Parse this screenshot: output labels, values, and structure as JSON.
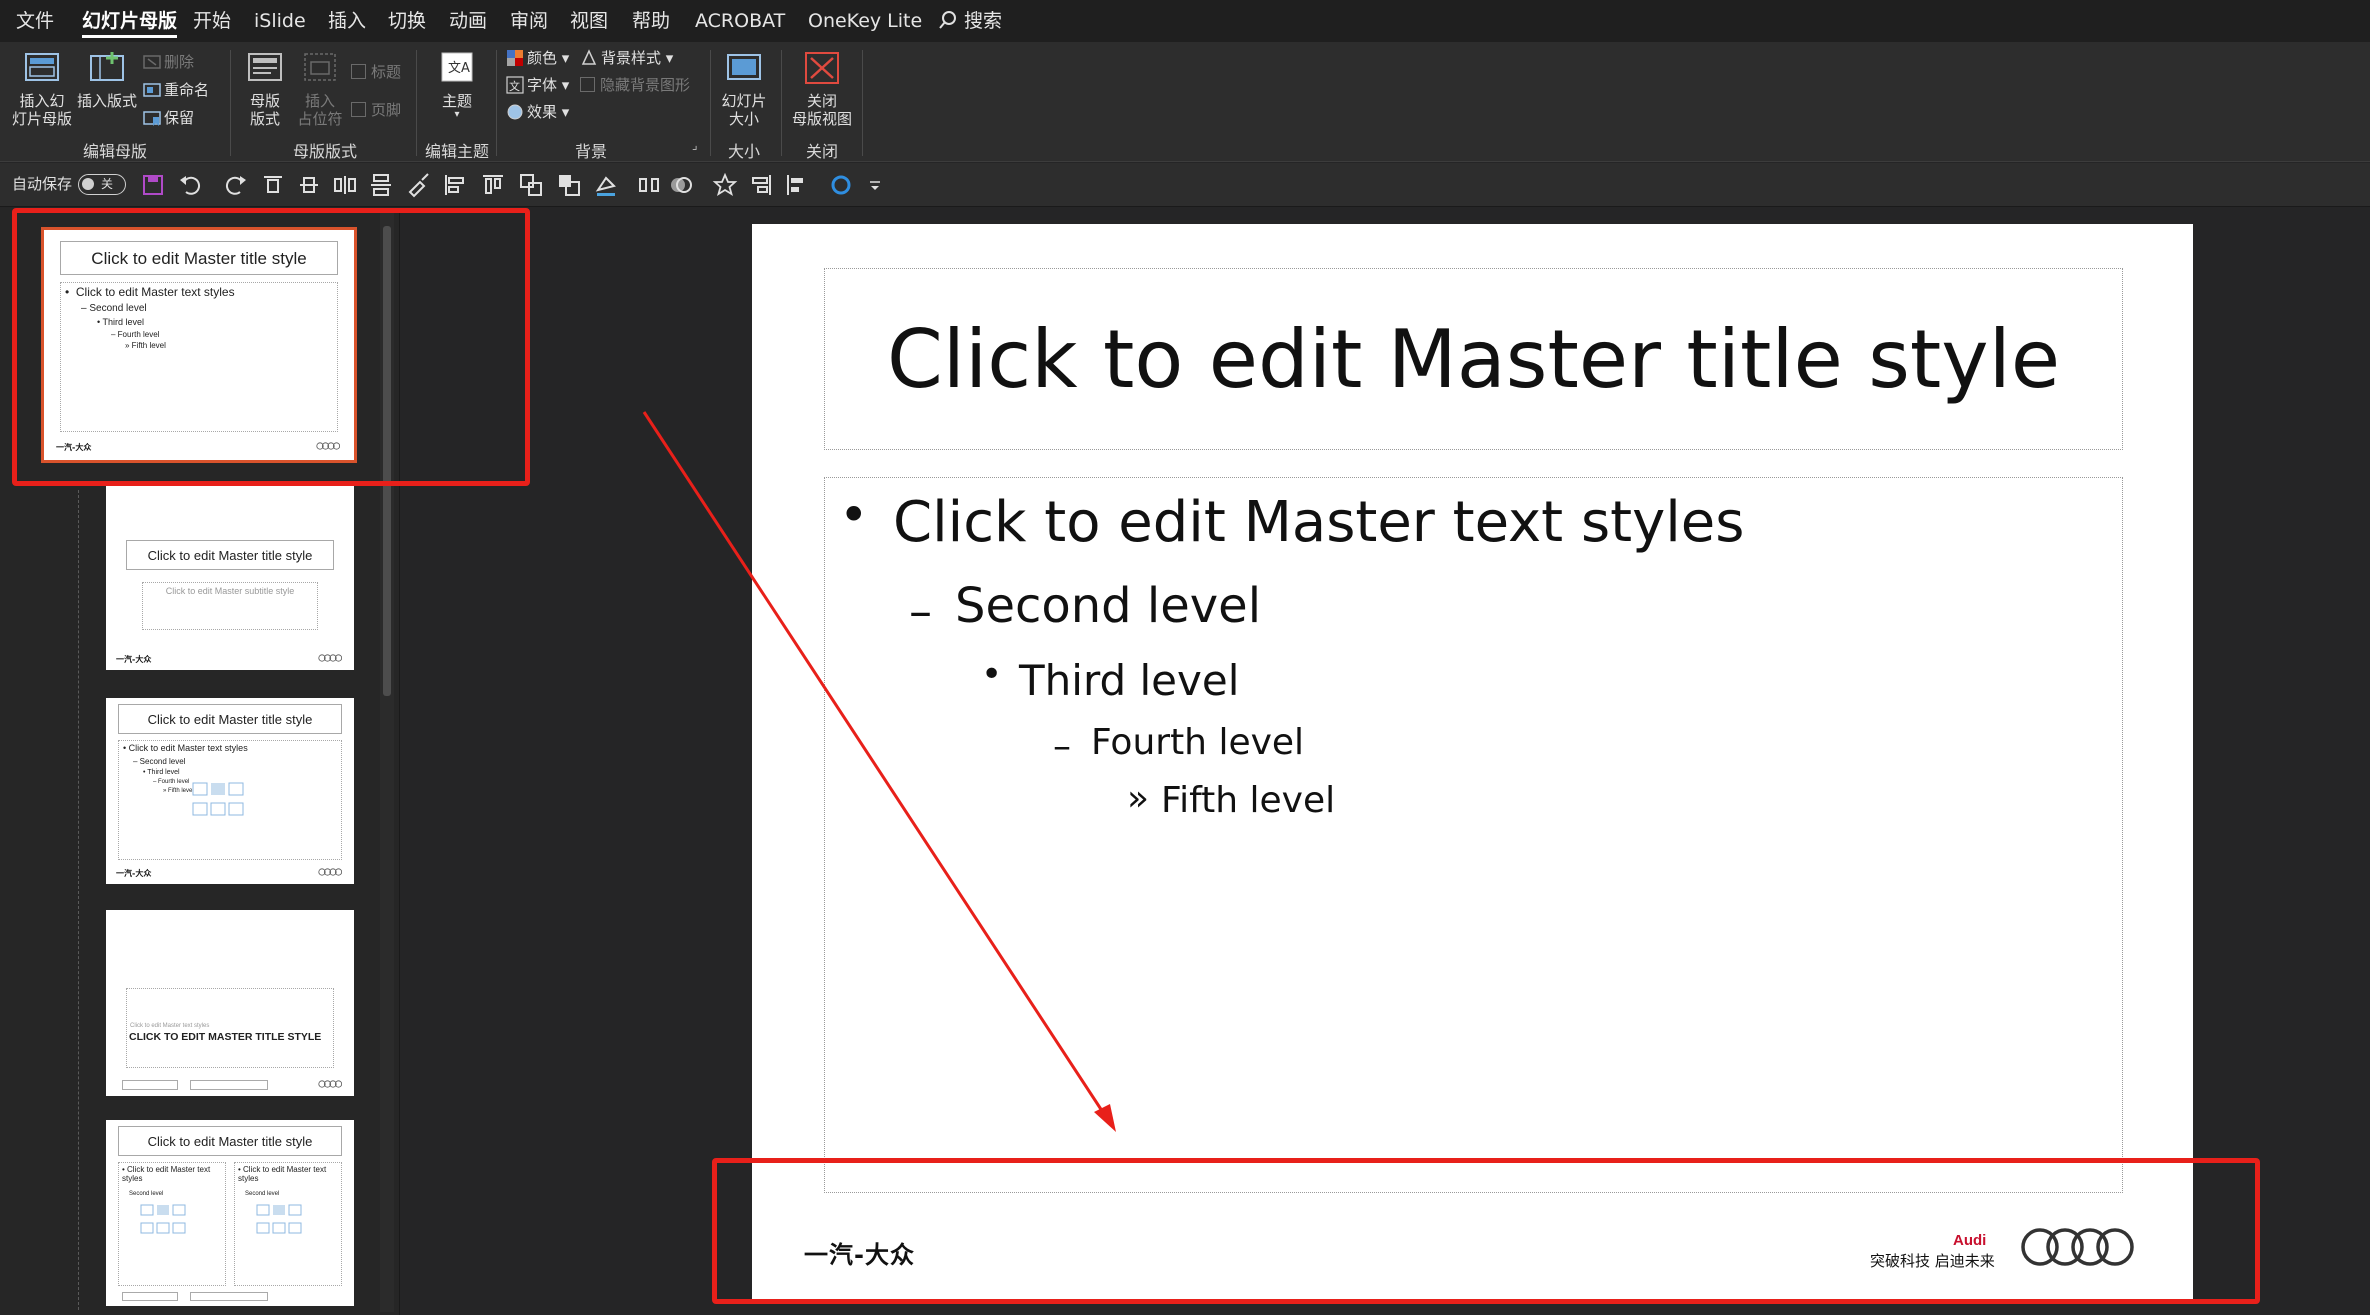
{
  "menu": {
    "items": [
      "文件",
      "幻灯片母版",
      "开始",
      "iSlide",
      "插入",
      "切换",
      "动画",
      "审阅",
      "视图",
      "帮助",
      "ACROBAT",
      "OneKey Lite"
    ],
    "search_label": "搜索",
    "active_index": 1
  },
  "ribbon": {
    "edit_master": {
      "label": "编辑母版",
      "insert_slide_master": "插入幻\n灯片母版",
      "insert_layout": "插入版式",
      "delete": "删除",
      "rename": "重命名",
      "preserve": "保留"
    },
    "master_layout": {
      "label": "母版版式",
      "master_layout_btn": "母版\n版式",
      "insert_placeholder": "插入\n占位符",
      "title_check": "标题",
      "footer_check": "页脚"
    },
    "edit_theme": {
      "label": "编辑主题",
      "themes": "主题"
    },
    "background": {
      "label": "背景",
      "colors": "颜色",
      "fonts": "字体",
      "effects": "效果",
      "bg_styles": "背景样式",
      "hide_bg_graphics": "隐藏背景图形"
    },
    "size": {
      "label": "大小",
      "slide_size": "幻灯片\n大小"
    },
    "close": {
      "label": "关闭",
      "close_master_view": "关闭\n母版视图"
    }
  },
  "qat": {
    "autosave_label": "自动保存",
    "autosave_state": "关"
  },
  "thumbnails": [
    {
      "title": "Click to edit Master title style",
      "levels": [
        "Click to edit Master text styles",
        "Second level",
        "Third level",
        "Fourth level",
        "Fifth level"
      ],
      "selected": true
    },
    {
      "title": "Click to edit Master title style",
      "subtitle": "Click to edit Master subtitle style"
    },
    {
      "title": "Click to edit Master title style",
      "levels": [
        "Click to edit Master text styles",
        "Second level",
        "Third level",
        "Fourth level",
        "Fifth level"
      ]
    },
    {
      "title": "CLICK TO EDIT MASTER TITLE STYLE",
      "subtitle": "Click to edit Master text styles"
    },
    {
      "title": "Click to edit Master title style",
      "left_col": "Click to edit Master text styles",
      "right_col": "Click to edit Master text styles",
      "sub": "Second level"
    }
  ],
  "slide": {
    "title": "Click to edit Master title style",
    "levels": [
      "Click to edit Master text styles",
      "Second level",
      "Third level",
      "Fourth level",
      "Fifth level"
    ],
    "bullets": [
      "•",
      "–",
      "•",
      "–",
      "»"
    ],
    "footer_left": "一汽-大众",
    "brand_audi": "Audi",
    "brand_slogan": "突破科技 启迪未来"
  },
  "colors": {
    "annotation_red": "#e8201a",
    "app_bg": "#252526",
    "ribbon_bg": "#2d2d2d",
    "audi_red": "#c8102e"
  }
}
